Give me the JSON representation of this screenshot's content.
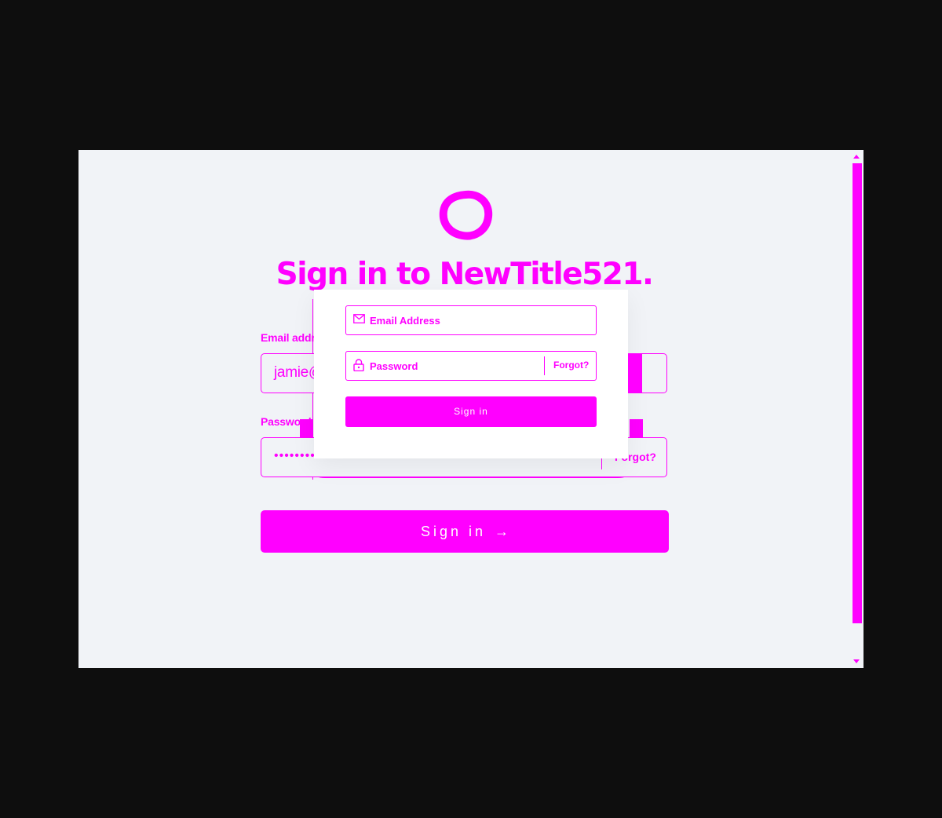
{
  "page": {
    "title": "Sign in to NewTitle521.",
    "accent_color": "#ff00ff",
    "background_color": "#f1f3f7",
    "outer_background": "#0e0e0e"
  },
  "form": {
    "email_label": "Email address",
    "email_value": "jamie@example.com",
    "password_label": "Password",
    "password_mask": "•••••••••••••••",
    "forgot_label": "Forgot?",
    "submit_label": "Sign in",
    "submit_icon": "arrow-right-icon"
  },
  "popup": {
    "email_placeholder": "Email Address",
    "email_icon": "mail-icon",
    "password_placeholder": "Password",
    "password_icon": "lock-icon",
    "forgot_label": "Forgot?",
    "submit_label": "Sign in"
  },
  "logo": {
    "icon": "circle-logo-icon"
  },
  "scrollbar": {
    "up_icon": "scroll-up-icon",
    "down_icon": "scroll-down-icon"
  }
}
